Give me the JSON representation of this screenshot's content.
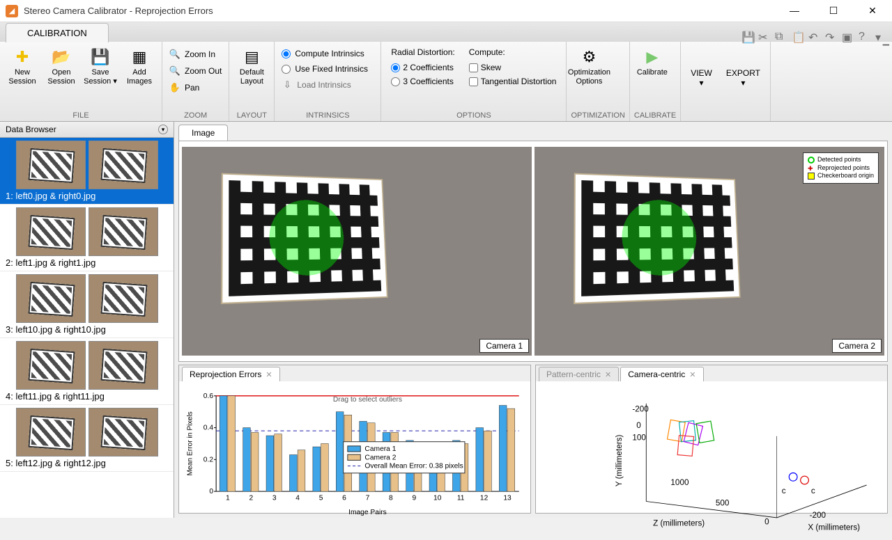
{
  "window": {
    "title": "Stereo Camera Calibrator - Reprojection Errors"
  },
  "ribbon": {
    "tab": "CALIBRATION",
    "file": {
      "group": "FILE",
      "new": "New\nSession",
      "open": "Open\nSession",
      "save": "Save\nSession",
      "add": "Add\nImages"
    },
    "zoom": {
      "group": "ZOOM",
      "in": "Zoom In",
      "out": "Zoom Out",
      "pan": "Pan"
    },
    "layout": {
      "group": "LAYOUT",
      "default": "Default\nLayout"
    },
    "intrinsics": {
      "group": "INTRINSICS",
      "compute": "Compute Intrinsics",
      "fixed": "Use Fixed Intrinsics",
      "load": "Load Intrinsics"
    },
    "options": {
      "group": "OPTIONS",
      "radial_hdr": "Radial Distortion:",
      "two": "2 Coefficients",
      "three": "3 Coefficients",
      "compute_hdr": "Compute:",
      "skew": "Skew",
      "tang": "Tangential Distortion"
    },
    "optimization": {
      "group": "OPTIMIZATION",
      "opts": "Optimization\nOptions"
    },
    "calibrate": {
      "group": "CALIBRATE",
      "btn": "Calibrate"
    },
    "view": "VIEW",
    "export": "EXPORT"
  },
  "browser": {
    "title": "Data Browser",
    "items": [
      {
        "label": "1: left0.jpg & right0.jpg"
      },
      {
        "label": "2: left1.jpg & right1.jpg"
      },
      {
        "label": "3: left10.jpg & right10.jpg"
      },
      {
        "label": "4: left11.jpg & right11.jpg"
      },
      {
        "label": "5: left12.jpg & right12.jpg"
      }
    ]
  },
  "image_panel": {
    "tab": "Image",
    "cam1": "Camera 1",
    "cam2": "Camera 2",
    "legend": {
      "detected": "Detected points",
      "reprojected": "Reprojected points",
      "origin": "Checkerboard origin"
    }
  },
  "reproj": {
    "tab": "Reprojection Errors",
    "drag": "Drag to select outliers",
    "ylabel": "Mean Error in Pixels",
    "xlabel": "Image Pairs",
    "legend": {
      "c1": "Camera 1",
      "c2": "Camera 2",
      "mean": "Overall Mean Error: 0.38 pixels"
    }
  },
  "centric": {
    "pattern": "Pattern-centric",
    "camera": "Camera-centric",
    "ylabel": "Y (millimeters)",
    "zlabel": "Z (millimeters)",
    "xlabel": "X (millimeters)"
  },
  "chart_data": {
    "type": "bar",
    "title": "Reprojection Errors",
    "xlabel": "Image Pairs",
    "ylabel": "Mean Error in Pixels",
    "ylim": [
      0,
      0.6
    ],
    "categories": [
      "1",
      "2",
      "3",
      "4",
      "5",
      "6",
      "7",
      "8",
      "9",
      "10",
      "11",
      "12",
      "13"
    ],
    "series": [
      {
        "name": "Camera 1",
        "values": [
          0.6,
          0.4,
          0.35,
          0.23,
          0.28,
          0.5,
          0.44,
          0.37,
          0.32,
          0.28,
          0.32,
          0.4,
          0.54
        ]
      },
      {
        "name": "Camera 2",
        "values": [
          0.6,
          0.37,
          0.36,
          0.26,
          0.3,
          0.48,
          0.43,
          0.37,
          0.3,
          0.28,
          0.3,
          0.38,
          0.52
        ]
      }
    ],
    "overall_mean": 0.38
  }
}
